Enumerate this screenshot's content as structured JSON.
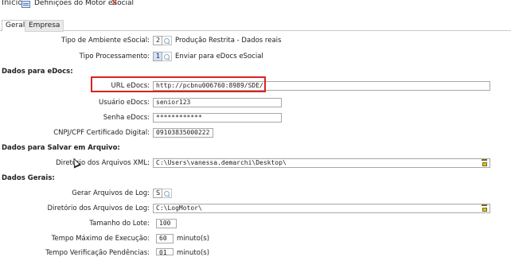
{
  "topbar": {
    "home": "Início",
    "tab_title": "Definições do Motor eSocial"
  },
  "tabs": [
    {
      "label": "Geral"
    },
    {
      "label": "Empresa"
    }
  ],
  "general": {
    "ambiente_label": "Tipo de Ambiente eSocial:",
    "ambiente_value": "2",
    "ambiente_desc": "Produção Restrita - Dados reais",
    "processamento_label": "Tipo Processamento:",
    "processamento_value": "1",
    "processamento_desc": "Enviar para eDocs eSocial"
  },
  "edocs": {
    "section": "Dados para eDocs:",
    "url_label": "URL eDocs:",
    "url_value": "http://pcbnu006760:8989/SDE/",
    "user_label": "Usuário eDocs:",
    "user_value": "senior123",
    "pass_label": "Senha eDocs:",
    "pass_value": "************",
    "cert_label": "CNPJ/CPF Certificado Digital:",
    "cert_value": "09103835000222"
  },
  "arquivo": {
    "section": "Dados para Salvar em Arquivo:",
    "dir_label": "Diretório dos Arquivos XML:",
    "dir_value": "C:\\Users\\vanessa.demarchi\\Desktop\\"
  },
  "gerais": {
    "section": "Dados Gerais:",
    "log_label": "Gerar Arquivos de Log:",
    "log_value": "S",
    "logdir_label": "Diretório dos Arquivos de Log:",
    "logdir_value": "C:\\LogMotor\\",
    "lote_label": "Tamanho do Lote:",
    "lote_value": "100",
    "tempo_label": "Tempo Máximo de Execução:",
    "tempo_value": "60",
    "tempo_unit": "minuto(s)",
    "pend_label": "Tempo Verificação Pendências:",
    "pend_value": "01",
    "pend_unit": "minuto(s)"
  },
  "colors": {
    "highlight": "#e02020",
    "close": "#c0392b"
  },
  "icons": {
    "close": "close-icon",
    "search": "search-icon",
    "browse": "folder-browse-icon",
    "doc": "document-icon"
  }
}
